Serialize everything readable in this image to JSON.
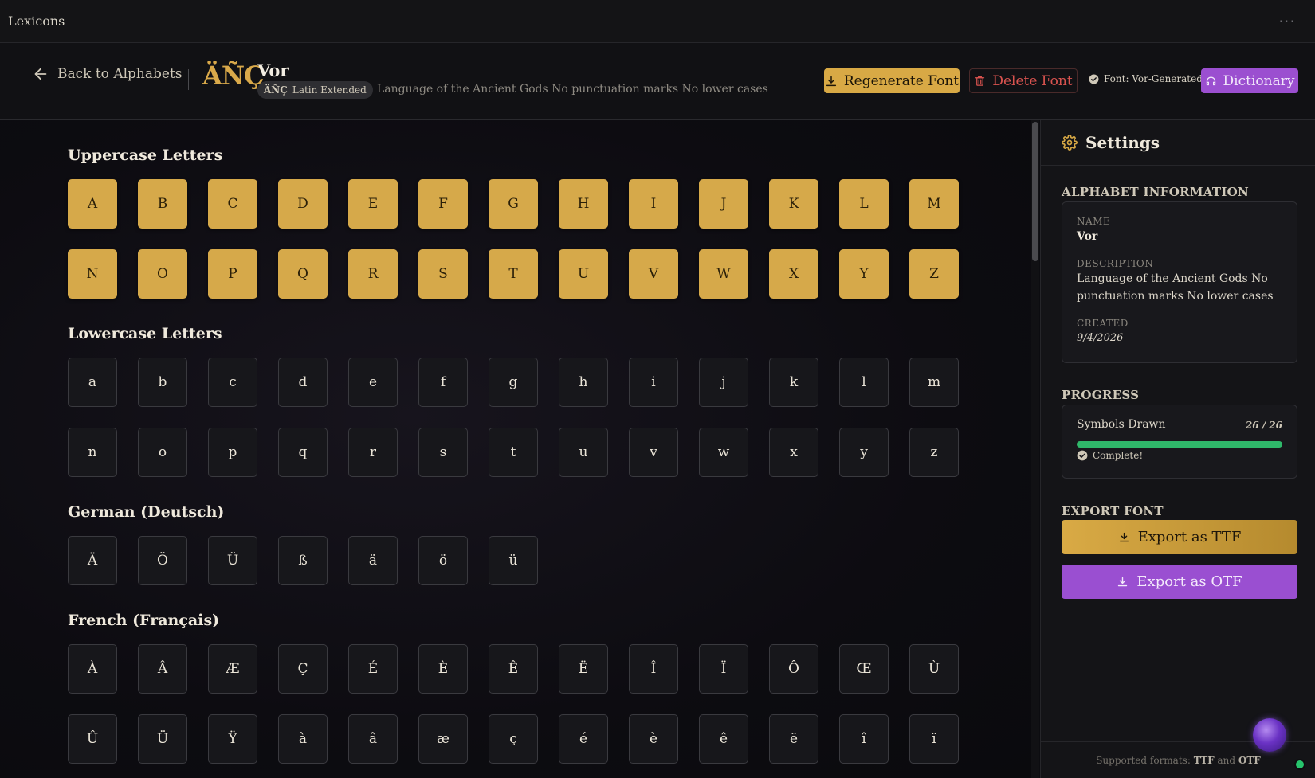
{
  "app": {
    "title": "Lexicons",
    "more": "···"
  },
  "header": {
    "back_label": "Back to Alphabets",
    "logo_glyphs": "ÄÑÇ",
    "font_name": "Vor",
    "badge_glyphs": "ÄÑÇ",
    "badge_label": "Latin Extended",
    "description": "Language of the Ancient Gods No punctuation marks No lower cases",
    "regenerate_label": "Regenerate Font",
    "delete_label": "Delete Font",
    "font_status": "Font: Vor-Generated",
    "dictionary_label": "Dictionary",
    "colors": {
      "gold": "#d8a945",
      "purple": "#9b4fd0",
      "danger": "#d9534f"
    }
  },
  "sections": {
    "uppercase": {
      "title": "Uppercase Letters",
      "row1": [
        "A",
        "B",
        "C",
        "D",
        "E",
        "F",
        "G",
        "H",
        "I",
        "J",
        "K",
        "L",
        "M"
      ],
      "row2": [
        "N",
        "O",
        "P",
        "Q",
        "R",
        "S",
        "T",
        "U",
        "V",
        "W",
        "X",
        "Y",
        "Z"
      ]
    },
    "lowercase": {
      "title": "Lowercase Letters",
      "row1": [
        "a",
        "b",
        "c",
        "d",
        "e",
        "f",
        "g",
        "h",
        "i",
        "j",
        "k",
        "l",
        "m"
      ],
      "row2": [
        "n",
        "o",
        "p",
        "q",
        "r",
        "s",
        "t",
        "u",
        "v",
        "w",
        "x",
        "y",
        "z"
      ]
    },
    "german": {
      "title": "German (Deutsch)",
      "row1": [
        "Ä",
        "Ö",
        "Ü",
        "ß",
        "ä",
        "ö",
        "ü"
      ]
    },
    "french": {
      "title": "French (Français)",
      "row1": [
        "À",
        "Â",
        "Æ",
        "Ç",
        "É",
        "È",
        "Ê",
        "Ë",
        "Î",
        "Ï",
        "Ô",
        "Œ",
        "Ù"
      ],
      "row2": [
        "Û",
        "Ü",
        "Ÿ",
        "à",
        "â",
        "æ",
        "ç",
        "é",
        "è",
        "ê",
        "ë",
        "î",
        "ï"
      ]
    }
  },
  "sidebar": {
    "title": "Settings",
    "alphabet_info": {
      "heading": "ALPHABET INFORMATION",
      "name_label": "NAME",
      "name_value": "Vor",
      "description_label": "DESCRIPTION",
      "description_value": "Language of the Ancient Gods No punctuation marks No lower cases",
      "created_label": "CREATED",
      "created_value": "9/4/2026"
    },
    "progress": {
      "heading": "PROGRESS",
      "label": "Symbols Drawn",
      "count": "26 / 26",
      "fraction": 1.0,
      "status": "Complete!"
    },
    "export": {
      "heading": "EXPORT FONT",
      "ttf_label": "Export as TTF",
      "otf_label": "Export as OTF"
    },
    "footer": {
      "prefix": "Supported formats:",
      "fmt1": "TTF",
      "and": "and",
      "fmt2": "OTF"
    }
  }
}
